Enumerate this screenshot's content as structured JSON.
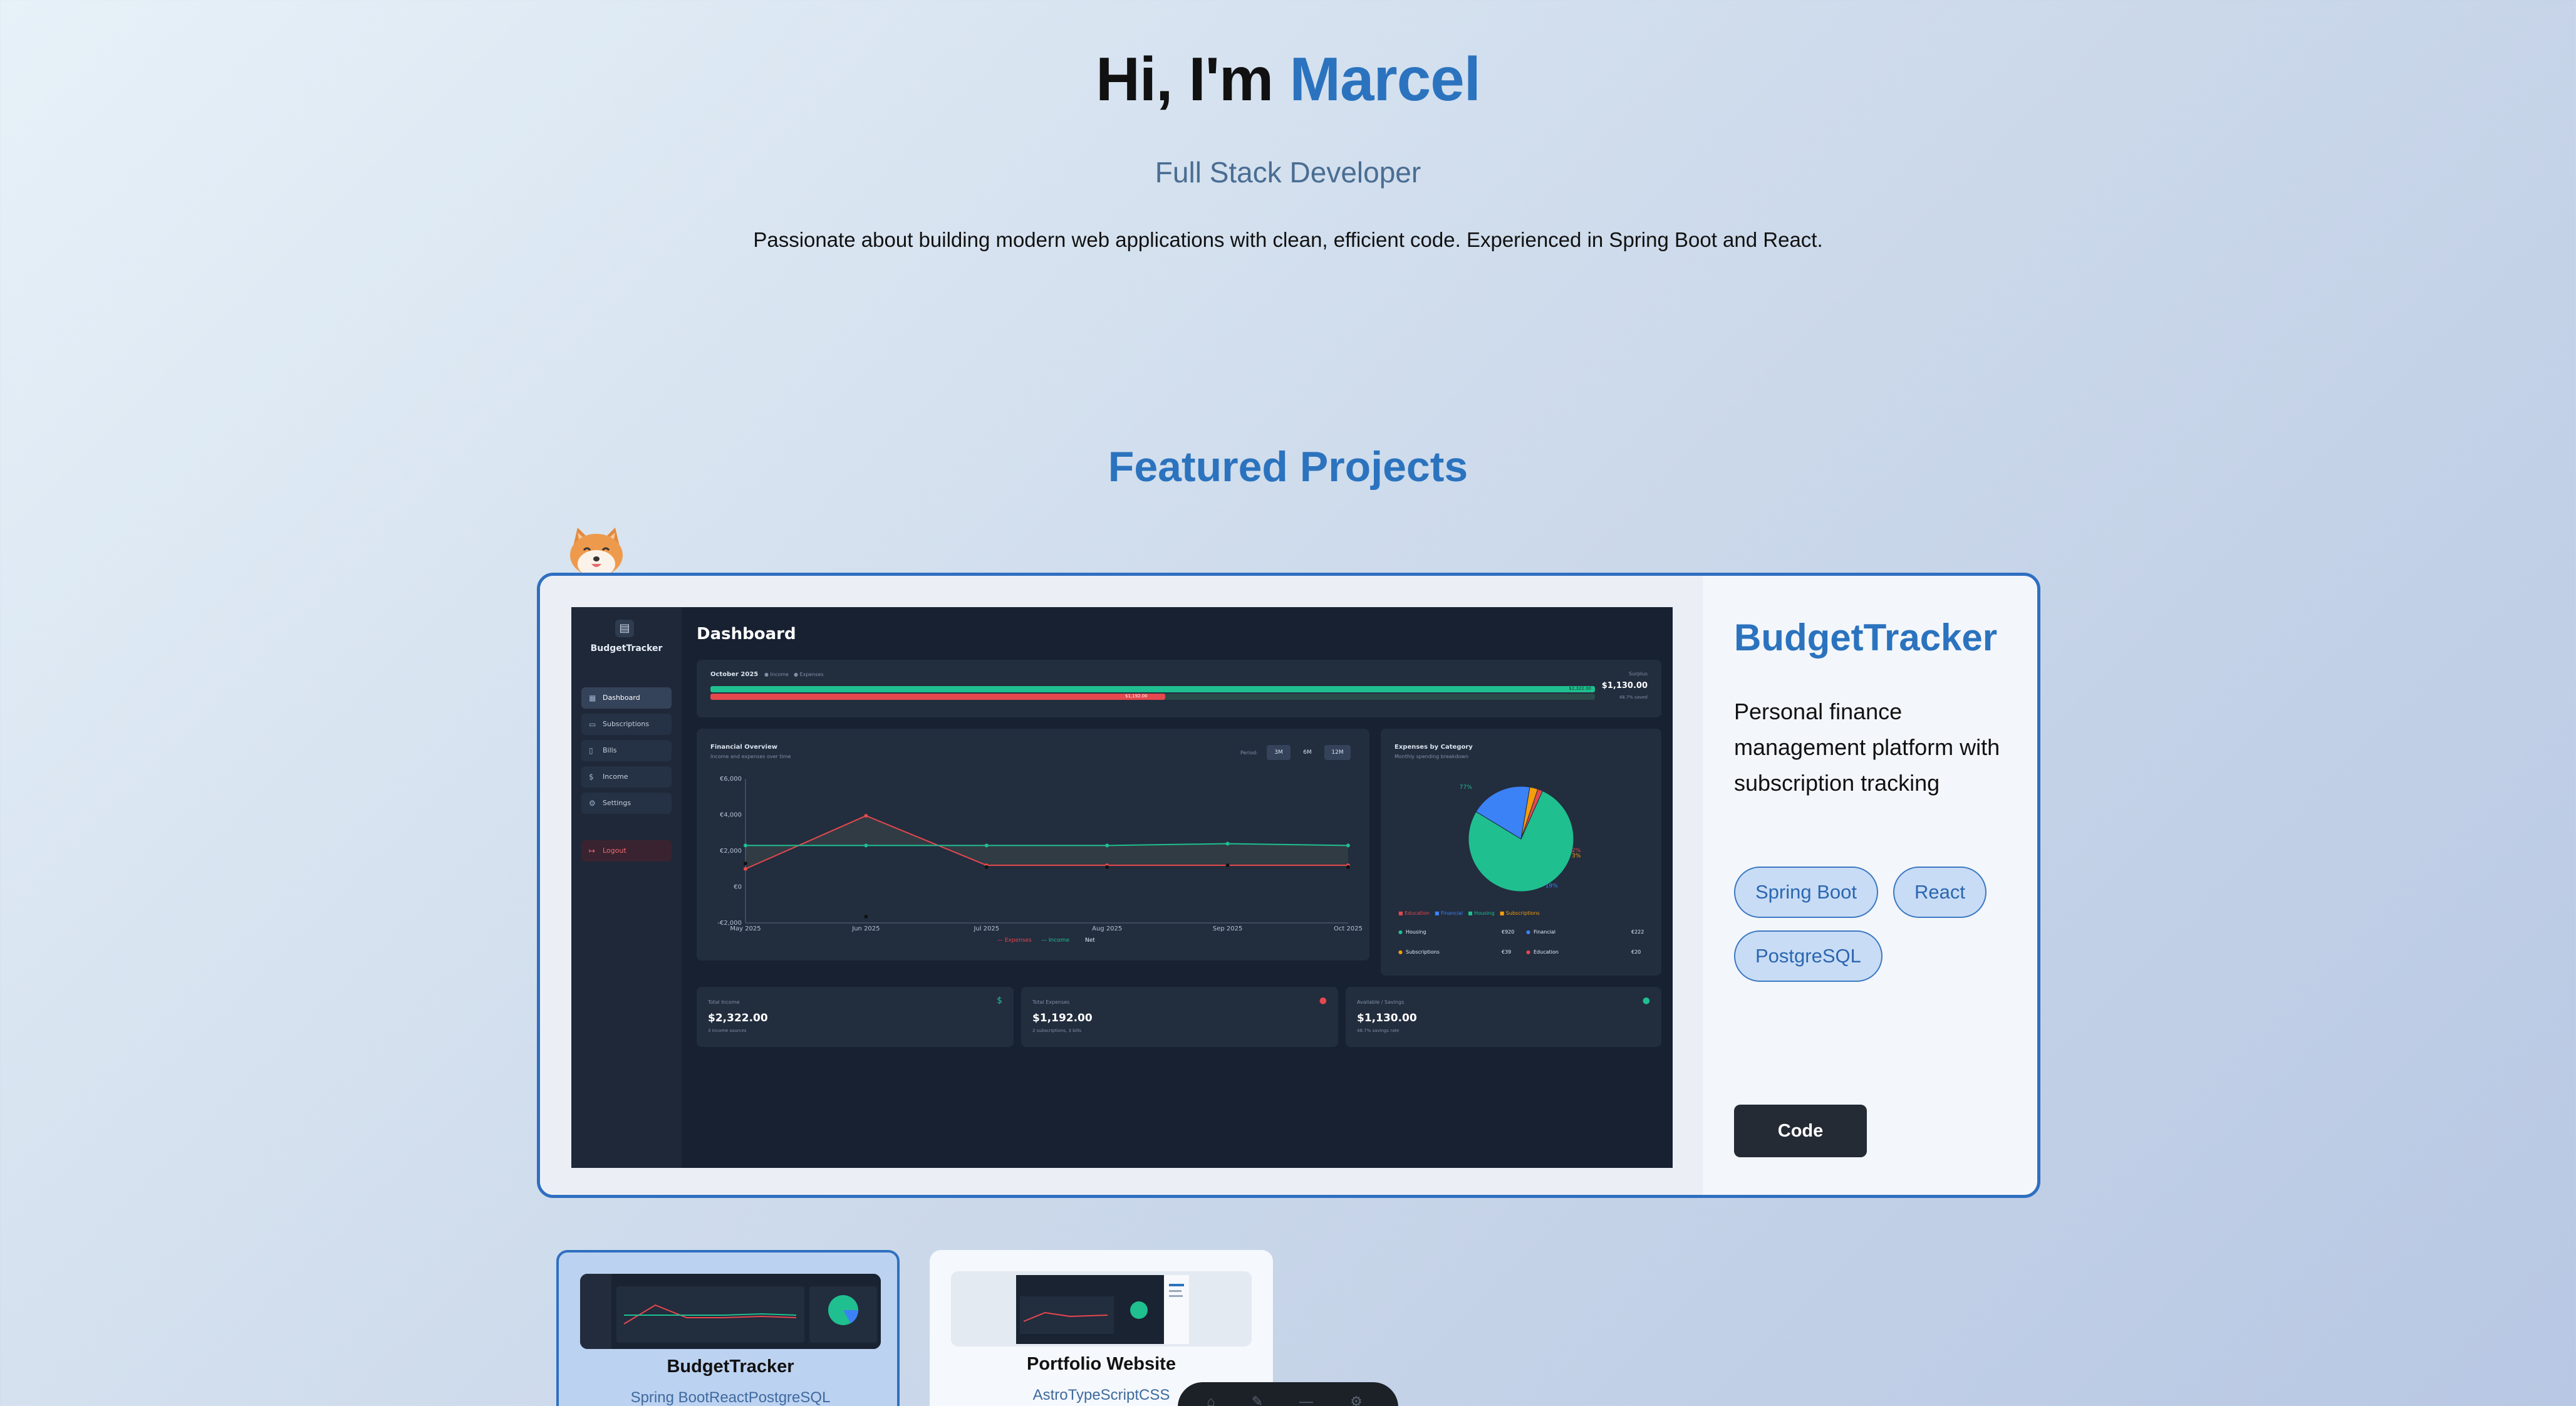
{
  "hero": {
    "greeting": "Hi, I'm",
    "name": "Marcel",
    "role": "Full Stack Developer",
    "description": "Passionate about building modern web applications with clean, efficient code. Experienced in Spring Boot and React."
  },
  "projects_section": {
    "title": "Featured Projects"
  },
  "featured": {
    "title": "BudgetTracker",
    "description": "Personal finance management platform with subscription tracking",
    "tags": [
      "Spring Boot",
      "React",
      "PostgreSQL"
    ],
    "code_button": "Code",
    "preview": {
      "brand": "BudgetTracker",
      "nav": [
        "Dashboard",
        "Subscriptions",
        "Bills",
        "Income",
        "Settings"
      ],
      "logout": "Logout",
      "page_title": "Dashboard",
      "month": "October 2025",
      "legend_income": "Income",
      "legend_expenses": "Expenses",
      "income_bar_value": "$2,322.00",
      "expense_bar_value": "$1,192.00",
      "surplus_label": "Surplus",
      "surplus_value": "$1,130.00",
      "surplus_sub": "48.7% saved",
      "overview_title": "Financial Overview",
      "overview_sub": "Income and expenses over time",
      "period_label": "Period:",
      "periods": [
        "3M",
        "6M",
        "12M"
      ],
      "category_title": "Expenses by Category",
      "category_sub": "Monthly spending breakdown",
      "stat_cards": [
        {
          "label": "Total Income",
          "value": "$2,322.00",
          "sub": "3 income sources"
        },
        {
          "label": "Total Expenses",
          "value": "$1,192.00",
          "sub": "2 subscriptions, 3 bills"
        },
        {
          "label": "Available / Savings",
          "value": "$1,130.00",
          "sub": "48.7% savings rate"
        }
      ],
      "category_rows": [
        {
          "left_name": "Housing",
          "left_value": "€920",
          "right_name": "Financial",
          "right_value": "€222"
        },
        {
          "left_name": "Subscriptions",
          "left_value": "€39",
          "right_name": "Education",
          "right_value": "€20"
        }
      ]
    }
  },
  "chart_data": {
    "type": "line",
    "title": "Financial Overview",
    "x": [
      "May 2025",
      "Jun 2025",
      "Jul 2025",
      "Aug 2025",
      "Sep 2025",
      "Oct 2025"
    ],
    "ylim": [
      -2000,
      6000
    ],
    "yticks": [
      "€6,000",
      "€4,000",
      "€2,000",
      "€0",
      "-€2,000"
    ],
    "series": [
      {
        "name": "Expenses",
        "color": "#e5484d",
        "values": [
          1000,
          3950,
          1200,
          1200,
          1200,
          1200
        ]
      },
      {
        "name": "Income",
        "color": "#1fbf8f",
        "values": [
          2300,
          2300,
          2300,
          2300,
          2400,
          2300
        ]
      },
      {
        "name": "Net",
        "color": "#111111",
        "values": [
          1300,
          -1650,
          1100,
          1100,
          1200,
          1100
        ]
      }
    ]
  },
  "pie_data": {
    "type": "pie",
    "legend": [
      "Education",
      "Financial",
      "Housing",
      "Subscriptions"
    ],
    "slice_labels": [
      "77%",
      "19%",
      "3%",
      "2%"
    ]
  },
  "project_cards": [
    {
      "name": "BudgetTracker",
      "stack": "Spring BootReactPostgreSQL",
      "selected": true
    },
    {
      "name": "Portfolio Website",
      "stack": "AstroTypeScriptCSS",
      "selected": false
    }
  ],
  "colors": {
    "accent": "#2b73be",
    "income": "#1fbf8f",
    "expense": "#e5484d"
  }
}
